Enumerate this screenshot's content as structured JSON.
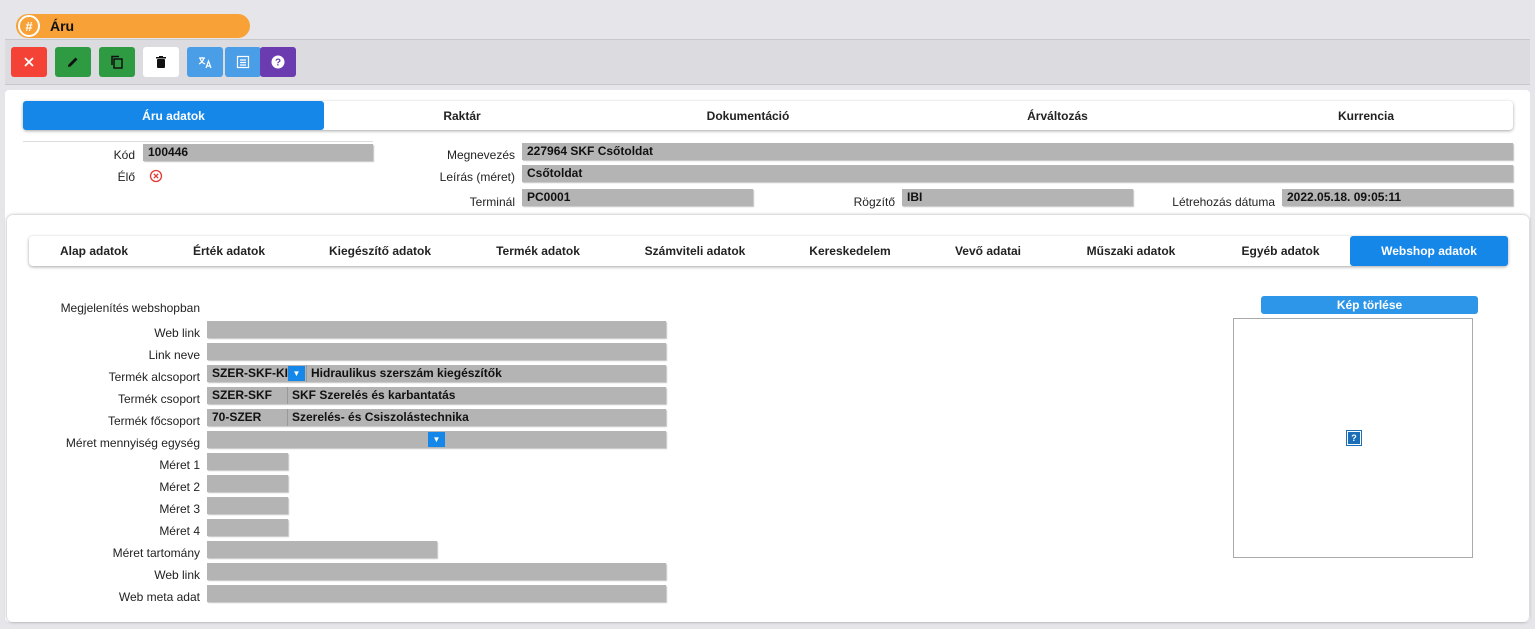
{
  "window": {
    "title": "Áru",
    "title_icon": "#"
  },
  "toolbar": {
    "buttons": [
      {
        "name": "close-button",
        "icon": "close-icon",
        "color": "#f44336"
      },
      {
        "name": "edit-button",
        "icon": "pencil-icon",
        "color": "#2e9b43"
      },
      {
        "name": "copy-button",
        "icon": "copy-icon",
        "color": "#2e9b43"
      },
      {
        "name": "delete-button",
        "icon": "trash-icon",
        "color": "#ffffff"
      },
      {
        "name": "translate-button",
        "icon": "translate-icon",
        "color": "#4a9ee8"
      },
      {
        "name": "list-button",
        "icon": "list-icon",
        "color": "#4a9ee8"
      },
      {
        "name": "help-button",
        "icon": "help-icon",
        "color": "#6a3cb0"
      }
    ]
  },
  "main_tabs": [
    "Áru adatok",
    "Raktár",
    "Dokumentáció",
    "Árváltozás",
    "Kurrencia"
  ],
  "header": {
    "kod_label": "Kód",
    "kod_value": "100446",
    "elo_label": "Élő",
    "megnevezes_label": "Megnevezés",
    "megnevezes_value": "227964 SKF Csőtoldat",
    "leiras_label": "Leírás (méret)",
    "leiras_value": "Csőtoldat",
    "terminal_label": "Terminál",
    "terminal_value": "PC0001",
    "rogzito_label": "Rögzítő",
    "rogzito_value": "IBI",
    "letrehozas_label": "Létrehozás dátuma",
    "letrehozas_value": "2022.05.18. 09:05:11"
  },
  "sub_tabs": [
    "Alap adatok",
    "Érték adatok",
    "Kiegészítő adatok",
    "Termék adatok",
    "Számviteli adatok",
    "Kereskedelem",
    "Vevő adatai",
    "Műszaki adatok",
    "Egyéb adatok",
    "Webshop adatok"
  ],
  "webshop": {
    "megjelenites_label": "Megjelenítés webshopban",
    "weblink_label": "Web link",
    "linkneve_label": "Link neve",
    "alcsoport_label": "Termék alcsoport",
    "alcsoport_code": "SZER-SKF-KIEG",
    "alcsoport_name": "Hidraulikus szerszám kiegészítők",
    "csoport_label": "Termék csoport",
    "csoport_code": "SZER-SKF",
    "csoport_name": "SKF Szerelés és karbantatás",
    "focsoport_label": "Termék főcsoport",
    "focsoport_code": "70-SZER",
    "focsoport_name": "Szerelés- és Csiszolástechnika",
    "meret_egyseg_label": "Méret mennyiség egység",
    "meret1_label": "Méret 1",
    "meret2_label": "Méret 2",
    "meret3_label": "Méret 3",
    "meret4_label": "Méret 4",
    "meret_tartomany_label": "Méret tartomány",
    "weblink2_label": "Web link",
    "meta_label": "Web meta adat",
    "kep_torlese_label": "Kép törlése",
    "image_placeholder": "?"
  }
}
